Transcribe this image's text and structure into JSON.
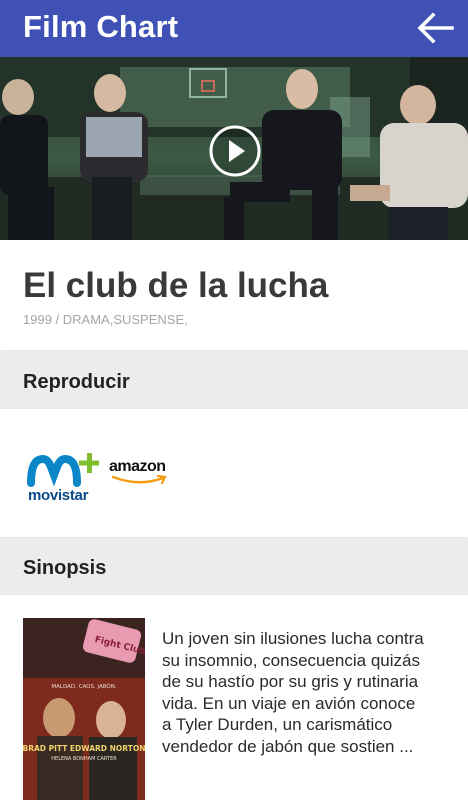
{
  "appbar": {
    "title": "Film Chart",
    "back_icon": "arrow-left-icon"
  },
  "hero": {
    "play_icon": "play-circle-icon"
  },
  "movie": {
    "title": "El club de la lucha",
    "meta": "1999 / DRAMA,SUSPENSE,"
  },
  "sections": {
    "play": "Reproducir",
    "synopsis": "Sinopsis"
  },
  "providers": [
    {
      "name": "movistar",
      "logo_text": "movistar"
    },
    {
      "name": "amazon",
      "logo_text": "amazon"
    }
  ],
  "poster": {
    "tagline": "MALDAD. CAOS. JABÓN.",
    "actors": "BRAD PITT EDWARD NORTON",
    "co_star": "HELENA BONHAM CARTER",
    "sign": "Fight Club"
  },
  "synopsis": {
    "text": "Un joven sin ilusiones lucha contra su insomnio, consecuencia quizás de su hastío por su gris y rutinaria vida. En un viaje en avión conoce a Tyler Durden, un carismático vendedor de jabón que sostien  ..."
  },
  "colors": {
    "primary": "#3f51b5",
    "section_bg": "#ececec",
    "meta_gray": "#a5a5a5"
  }
}
